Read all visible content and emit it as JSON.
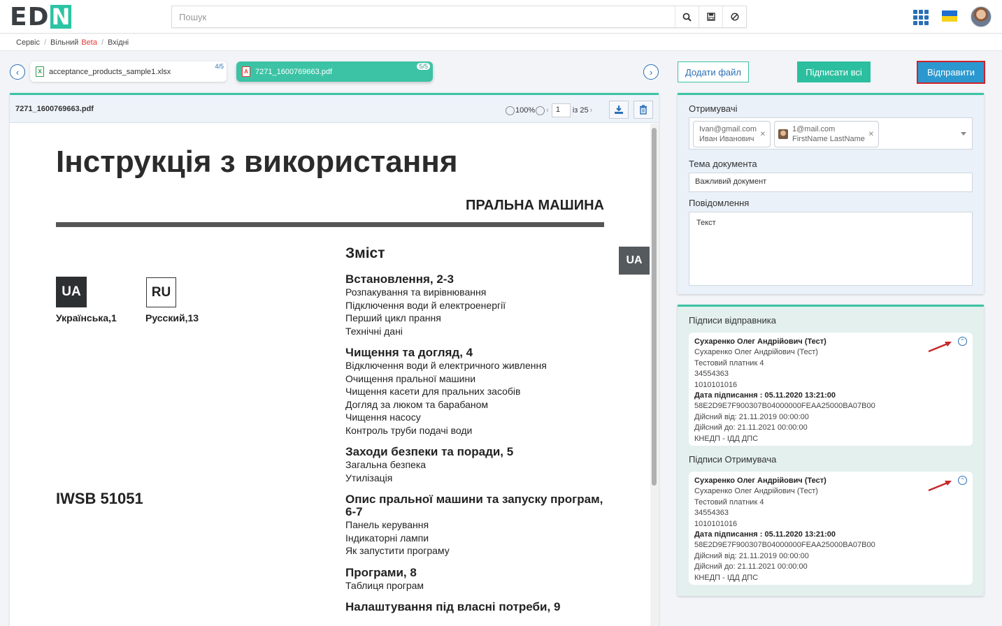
{
  "header": {
    "logo_prefix": "ED",
    "logo_mark": "N",
    "search_placeholder": "Пошук",
    "icons": [
      "search-icon",
      "save-icon",
      "block-icon",
      "apps-grid-icon",
      "ua-flag-icon",
      "user-avatar"
    ],
    "colors": {
      "accent": "#3cc3a5",
      "primary": "#2a6fb5",
      "send": "#2b98cf",
      "highlight": "#d0202a"
    }
  },
  "breadcrumb": {
    "items": [
      "Сервіс",
      "Вільний",
      "Вхідні"
    ],
    "beta": "Beta"
  },
  "tabs": [
    {
      "name": "acceptance_products_sample1.xlsx",
      "counter": "4/5",
      "icon": "excel-file-icon"
    },
    {
      "name": "7271_1600769663.pdf",
      "counter": "5/5",
      "icon": "pdf-file-icon"
    }
  ],
  "actions": {
    "add_file": "Додати файл",
    "sign_all": "Підписати всі",
    "send": "Відправити"
  },
  "viewer": {
    "file_name": "7271_1600769663.pdf",
    "zoom": "100%",
    "page": "1",
    "of_pages": "із 25"
  },
  "document": {
    "title": "Інструкція з використання",
    "subtitle": "ПРАЛЬНА МАШИНА",
    "lang_ua": "UA",
    "lang_ru": "RU",
    "lang_ua_label": "Українська,1",
    "lang_ru_label": "Русский,13",
    "side_tab": "UA",
    "model": "IWSB 51051",
    "toc_heading": "Зміст",
    "sections": [
      {
        "title": "Встановлення, 2-3",
        "items": [
          "Розпакування та вирівнювання",
          "Підключення води й електроенергії",
          "Перший цикл прання",
          "Технічні дані"
        ]
      },
      {
        "title": "Чищення та догляд, 4",
        "items": [
          "Відключення води й електричного живлення",
          "Очищення пральної машини",
          "Чищення касети для пральних засобів",
          "Догляд за люком та барабаном",
          "Чищення насосу",
          "Контроль труби подачі води"
        ]
      },
      {
        "title": "Заходи безпеки та поради, 5",
        "items": [
          "Загальна безпека",
          "Утилізація"
        ]
      },
      {
        "title": "Опис пральної машини та запуску програм, 6-7",
        "items": [
          "Панель керування",
          "Індикаторні лампи",
          "Як запустити програму"
        ]
      },
      {
        "title": "Програми, 8",
        "items": [
          "Таблиця програм"
        ]
      },
      {
        "title": "Налаштування під власні потреби, 9",
        "items": []
      }
    ]
  },
  "form": {
    "recipients_label": "Отримувачі",
    "recipients": [
      {
        "email": "Ivan@gmail.com",
        "name": "Иван Иванович"
      },
      {
        "email": "1@mail.com",
        "name": "FirstName LastName"
      }
    ],
    "subject_label": "Тема документа",
    "subject_value": "Важливий документ",
    "message_label": "Повідомлення",
    "message_value": "Текст"
  },
  "signatures": {
    "sender_label": "Підписи відправника",
    "receiver_label": "Підписи Отримувача",
    "sender": {
      "title": "Сухаренко Олег Андрійович (Тест)",
      "name": "Сухаренко Олег Андрійович (Тест)",
      "org": "Тестовий платник 4",
      "code1": "34554363",
      "code2": "1010101016",
      "date": "Дата підписання : 05.11.2020 13:21:00",
      "serial": "58E2D9E7F900307B04000000FEAA25000BA07B00",
      "valid_from": "Дійсний від: 21.11.2019 00:00:00",
      "valid_to": "Дійсний до: 21.11.2021 00:00:00",
      "issuer": "КНЕДП - ІДД ДПС"
    },
    "receiver": {
      "title": "Сухаренко Олег Андрійович (Тест)",
      "name": "Сухаренко Олег Андрійович (Тест)",
      "org": "Тестовий платник 4",
      "code1": "34554363",
      "code2": "1010101016",
      "date": "Дата підписання : 05.11.2020 13:21:00",
      "serial": "58E2D9E7F900307B04000000FEAA25000BA07B00",
      "valid_from": "Дійсний від: 21.11.2019 00:00:00",
      "valid_to": "Дійсний до: 21.11.2021 00:00:00",
      "issuer": "КНЕДП - ІДД ДПС"
    }
  }
}
